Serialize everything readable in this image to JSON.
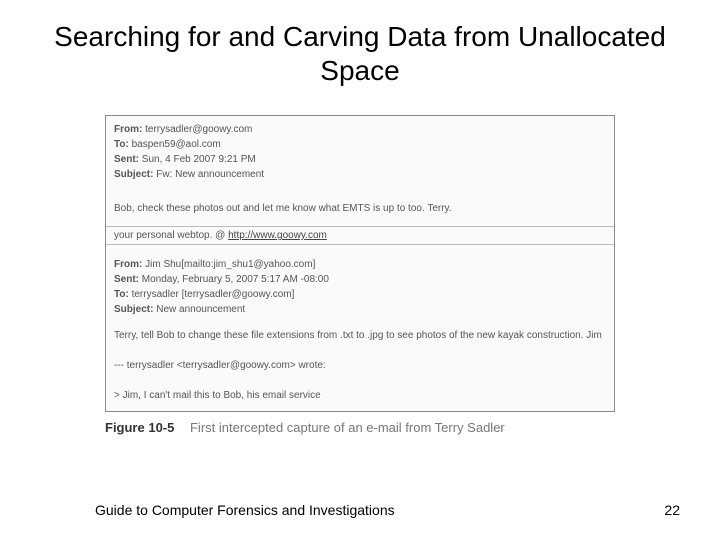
{
  "title": "Searching for and Carving Data from Unallocated Space",
  "email1": {
    "from_label": "From:",
    "from_value": "terrysadler@goowy.com",
    "to_label": "To:",
    "to_value": "baspen59@aol.com",
    "sent_label": "Sent:",
    "sent_value": "Sun, 4 Feb 2007 9:21 PM",
    "subject_label": "Subject:",
    "subject_value": "Fw: New announcement",
    "body": "Bob, check these photos out and let me know what EMTS is up to too. Terry."
  },
  "ad": {
    "text": "your personal webtop. @ ",
    "link_text": "http://www.goowy.com"
  },
  "email2": {
    "from_label": "From:",
    "from_value": "Jim Shu[mailto:jim_shu1@yahoo.com]",
    "sent_label": "Sent:",
    "sent_value": "Monday, February 5, 2007 5:17 AM -08:00",
    "to_label": "To:",
    "to_value": "terrysadler [terrysadler@goowy.com]",
    "subject_label": "Subject:",
    "subject_value": "New announcement",
    "body": "Terry, tell Bob to change these file extensions from .txt to .jpg to see photos of the new kayak construction. Jim",
    "quote_attrib": "--- terrysadler <terrysadler@goowy.com> wrote:",
    "quote_line": "> Jim, I can't mail this to Bob, his email service"
  },
  "figure": {
    "label": "Figure 10-5",
    "caption": "First intercepted capture of an e-mail from Terry Sadler"
  },
  "footer": {
    "left": "Guide to Computer Forensics and Investigations",
    "right": "22"
  }
}
